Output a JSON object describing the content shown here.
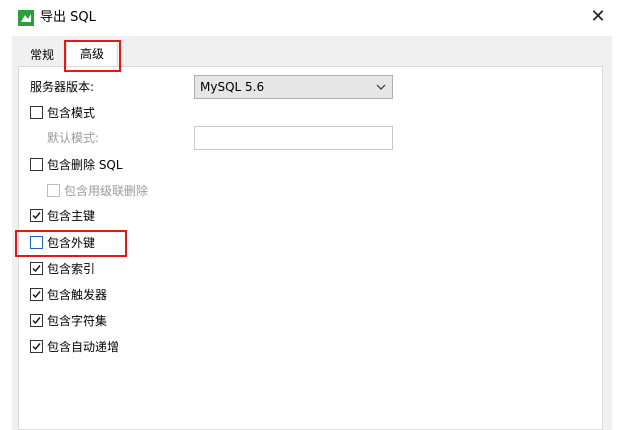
{
  "window": {
    "title": "导出 SQL",
    "close_symbol": "✕",
    "accent": "#e01919"
  },
  "tabs": [
    {
      "label": "常规",
      "active": false
    },
    {
      "label": "高级",
      "active": true
    }
  ],
  "form": {
    "server_version_label": "服务器版本:",
    "server_version_value": "MySQL 5.6",
    "default_schema_label": "默认模式:",
    "default_schema_value": ""
  },
  "options": [
    {
      "label": "包含模式",
      "checked": false,
      "enabled": true
    },
    {
      "label": "包含删除 SQL",
      "checked": false,
      "enabled": true
    },
    {
      "label": "包含用级联删除",
      "checked": false,
      "enabled": false
    },
    {
      "label": "包含主键",
      "checked": true,
      "enabled": true
    },
    {
      "label": "包含外键",
      "checked": false,
      "enabled": true
    },
    {
      "label": "包含索引",
      "checked": true,
      "enabled": true
    },
    {
      "label": "包含触发器",
      "checked": true,
      "enabled": true
    },
    {
      "label": "包含字符集",
      "checked": true,
      "enabled": true
    },
    {
      "label": "包含自动递增",
      "checked": true,
      "enabled": true
    }
  ]
}
